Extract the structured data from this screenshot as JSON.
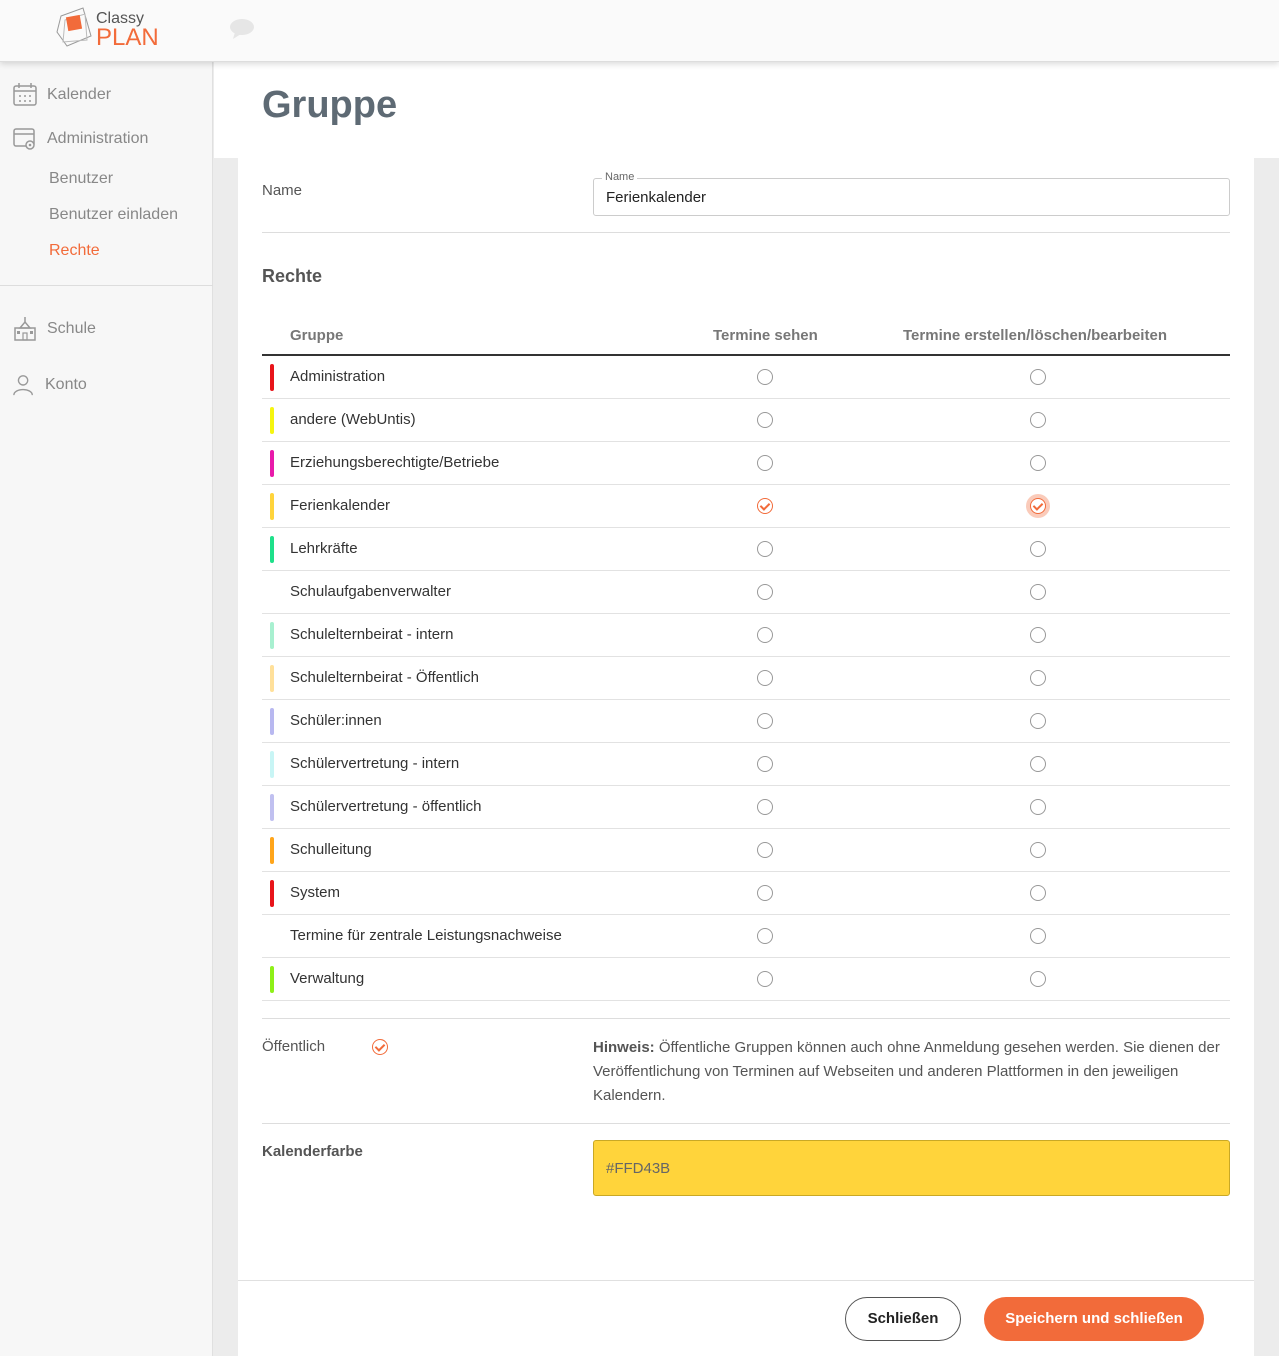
{
  "brand": {
    "line1": "Classy",
    "line2": "PLAN",
    "accent": "#f26b3a"
  },
  "sidebar": {
    "kalender": "Kalender",
    "administration": "Administration",
    "benutzer": "Benutzer",
    "benutzer_einladen": "Benutzer einladen",
    "rechte": "Rechte",
    "schule": "Schule",
    "konto": "Konto"
  },
  "page": {
    "title": "Gruppe"
  },
  "form": {
    "name_label": "Name",
    "name_legend": "Name",
    "name_value": "Ferienkalender",
    "rights_title": "Rechte",
    "columns": {
      "group": "Gruppe",
      "see": "Termine sehen",
      "edit": "Termine erstellen/löschen/bearbeiten"
    },
    "rows": [
      {
        "label": "Administration",
        "color": "#e8141a",
        "see": false,
        "edit": false
      },
      {
        "label": "andere (WebUntis)",
        "color": "#f5f510",
        "see": false,
        "edit": false
      },
      {
        "label": "Erziehungsberechtigte/Betriebe",
        "color": "#e81aaa",
        "see": false,
        "edit": false
      },
      {
        "label": "Ferienkalender",
        "color": "#ffd43b",
        "see": true,
        "edit": true
      },
      {
        "label": "Lehrkräfte",
        "color": "#1ee08a",
        "see": false,
        "edit": false
      },
      {
        "label": "Schulaufgabenverwalter",
        "color": "",
        "see": false,
        "edit": false
      },
      {
        "label": "Schulelternbeirat - intern",
        "color": "#a8f0d0",
        "see": false,
        "edit": false
      },
      {
        "label": "Schulelternbeirat - Öffentlich",
        "color": "#ffe09a",
        "see": false,
        "edit": false
      },
      {
        "label": "Schüler:innen",
        "color": "#b8b8f0",
        "see": false,
        "edit": false
      },
      {
        "label": "Schülervertretung - intern",
        "color": "#c8f5f5",
        "see": false,
        "edit": false
      },
      {
        "label": "Schülervertretung - öffentlich",
        "color": "#c0c0f0",
        "see": false,
        "edit": false
      },
      {
        "label": "Schulleitung",
        "color": "#ffa51a",
        "see": false,
        "edit": false
      },
      {
        "label": "System",
        "color": "#e8141a",
        "see": false,
        "edit": false
      },
      {
        "label": "Termine für zentrale Leistungsnachweise",
        "color": "",
        "see": false,
        "edit": false
      },
      {
        "label": "Verwaltung",
        "color": "#8ef018",
        "see": false,
        "edit": false
      }
    ],
    "public_label": "Öffentlich",
    "public_checked": true,
    "hint_bold": "Hinweis:",
    "hint_text": " Öffentliche Gruppen können auch ohne Anmeldung gesehen werden. Sie dienen der Veröffentlichung von Terminen auf Webseiten und anderen Plattformen in den jeweiligen Kalendern.",
    "color_label": "Kalenderfarbe",
    "color_value": "#FFD43B"
  },
  "footer": {
    "close": "Schließen",
    "save": "Speichern und schließen"
  }
}
